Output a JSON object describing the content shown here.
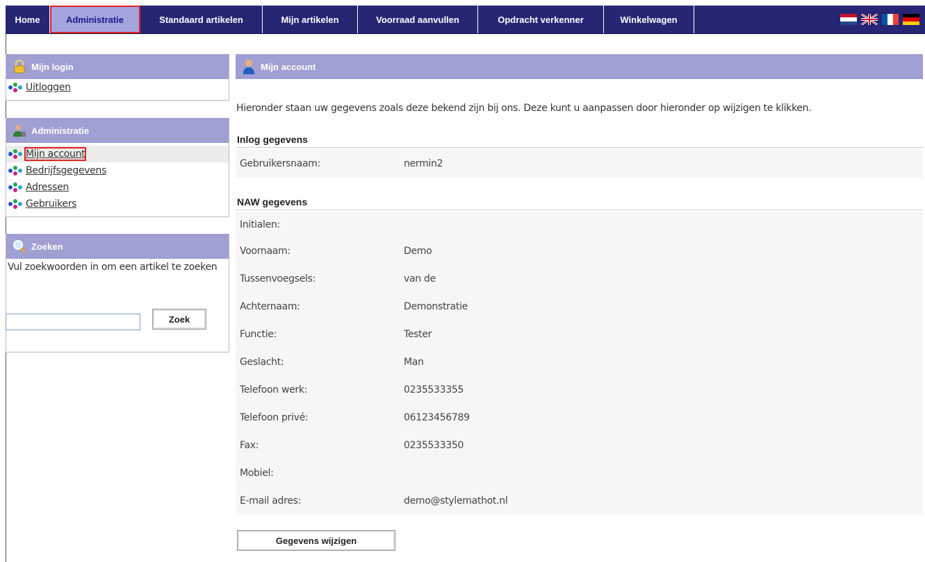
{
  "nav": {
    "tabs": [
      {
        "label": "Home",
        "active": false
      },
      {
        "label": "Administratie",
        "active": true
      },
      {
        "label": "Standaard artikelen",
        "active": false
      },
      {
        "label": "Mijn artikelen",
        "active": false
      },
      {
        "label": "Voorraad aanvullen",
        "active": false
      },
      {
        "label": "Opdracht verkenner",
        "active": false
      },
      {
        "label": "Winkelwagen",
        "active": false
      }
    ],
    "flags": [
      "flag-nl-icon",
      "flag-uk-icon",
      "flag-fr-icon",
      "flag-de-icon"
    ]
  },
  "sidebar": {
    "login": {
      "title": "Mijn login",
      "icon": "lock-icon",
      "links": [
        "Uitloggen"
      ]
    },
    "admin": {
      "title": "Administratie",
      "icon": "user-admin-icon",
      "links": [
        "Mijn account",
        "Bedrijfsgegevens",
        "Adressen",
        "Gebruikers"
      ]
    },
    "search": {
      "title": "Zoeken",
      "icon": "magnifier-icon",
      "description": "Vul zoekwoorden in om een artikel te zoeken",
      "input_value": "",
      "button_label": "Zoek"
    }
  },
  "main": {
    "title": "Mijn account",
    "icon": "user-icon",
    "intro": "Hieronder staan uw gegevens zoals deze bekend zijn bij ons. Deze kunt u aanpassen door hieronder op wijzigen te klikken.",
    "login_section": {
      "title": "Inlog gegevens",
      "rows": [
        {
          "label": "Gebruikersnaam:",
          "value": "nermin2"
        }
      ]
    },
    "naw_section": {
      "title": "NAW gegevens",
      "rows": [
        {
          "label": "Initialen:",
          "value": ""
        },
        {
          "label": "Voornaam:",
          "value": "Demo"
        },
        {
          "label": "Tussenvoegsels:",
          "value": "van de"
        },
        {
          "label": "Achternaam:",
          "value": "Demonstratie"
        },
        {
          "label": "Functie:",
          "value": "Tester"
        },
        {
          "label": "Geslacht:",
          "value": "Man"
        },
        {
          "label": "Telefoon werk:",
          "value": "0235533355"
        },
        {
          "label": "Telefoon privé:",
          "value": "06123456789"
        },
        {
          "label": "Fax:",
          "value": "0235533350"
        },
        {
          "label": "Mobiel:",
          "value": ""
        },
        {
          "label": "E-mail adres:",
          "value": "demo@stylemathot.nl"
        }
      ]
    },
    "edit_button": "Gegevens wijzigen"
  },
  "colors": {
    "nav_bg": "#262674",
    "nav_active_bg": "#a3a3dd",
    "header_bg": "#9f9fd2",
    "highlight_border": "#e02020"
  }
}
